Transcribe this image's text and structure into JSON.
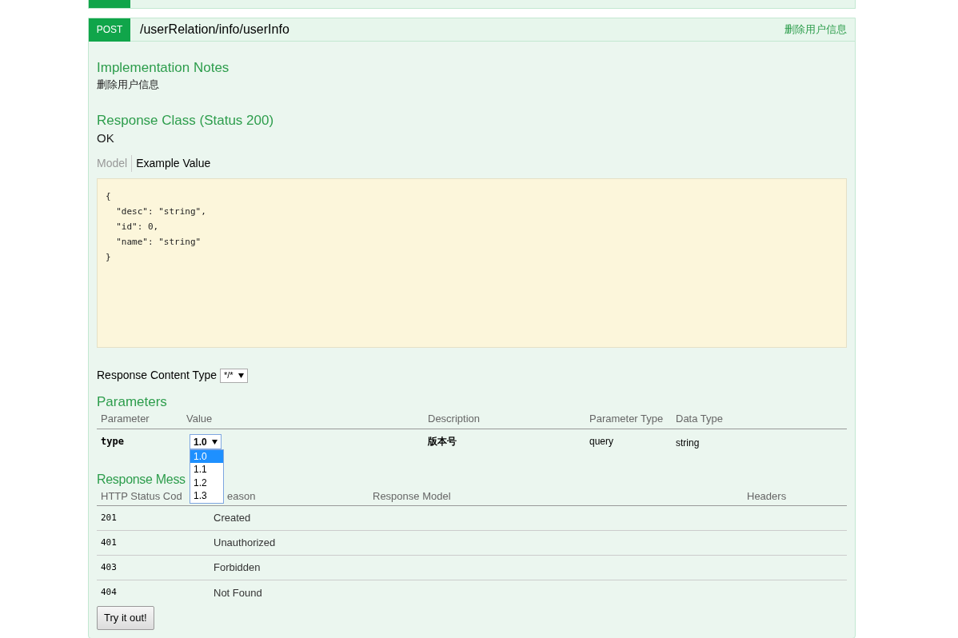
{
  "operation": {
    "method": "POST",
    "path": "/userRelation/info/userInfo",
    "summary": "删除用户信息"
  },
  "implementation_notes": {
    "title": "Implementation Notes",
    "text": "删除用户信息"
  },
  "response_class": {
    "title": "Response Class (Status 200)",
    "text": "OK"
  },
  "model_tabs": [
    {
      "label": "Model",
      "selected": false
    },
    {
      "label": "Example Value",
      "selected": true
    }
  ],
  "example_value": [
    "{",
    "  \"desc\": \"string\",",
    "  \"id\": 0,",
    "  \"name\": \"string\"",
    "}"
  ],
  "response_content_type": {
    "label": "Response Content Type",
    "value": "*/*"
  },
  "parameters": {
    "title": "Parameters",
    "columns": [
      "Parameter",
      "Value",
      "Description",
      "Parameter Type",
      "Data Type"
    ],
    "rows": [
      {
        "parameter": "type",
        "value": "1.0",
        "description": "版本号",
        "parameter_type": "query",
        "data_type": "string",
        "dropdown": {
          "expanded": true,
          "options": [
            {
              "label": "1.0",
              "selected": true
            },
            {
              "label": "1.1",
              "selected": false
            },
            {
              "label": "1.2",
              "selected": false
            },
            {
              "label": "1.3",
              "selected": false
            }
          ]
        }
      }
    ]
  },
  "response_messages": {
    "title": "Response Mess",
    "columns": [
      "HTTP Status Cod",
      "eason",
      "Response Model",
      "Headers"
    ],
    "rows": [
      {
        "code": "201",
        "reason": "Created"
      },
      {
        "code": "401",
        "reason": "Unauthorized"
      },
      {
        "code": "403",
        "reason": "Forbidden"
      },
      {
        "code": "404",
        "reason": "Not Found"
      }
    ]
  },
  "try_button": "Try it out!"
}
